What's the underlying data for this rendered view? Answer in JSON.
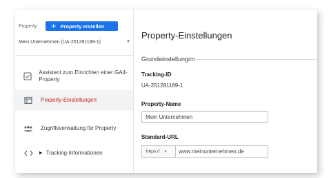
{
  "sidebar": {
    "property_label": "Property",
    "create_button_label": "Property erstellen",
    "account_selector": "Mein Unternehmen (UA-251281189-1)",
    "items": [
      {
        "icon": "checklist-icon",
        "label": "Assistent zum Einrichten einer GA4-Property",
        "active": false
      },
      {
        "icon": "page-layout-icon",
        "label": "Property-Einstellungen",
        "active": true
      },
      {
        "icon": "people-icon",
        "label": "Zugriffsverwaltung für Property",
        "active": false
      },
      {
        "icon": "code-icon",
        "label": "Tracking-Informationen",
        "active": false,
        "expandable": true
      }
    ]
  },
  "main": {
    "page_title": "Property-Einstellungen",
    "section_title": "Grundeinstellungen",
    "tracking_id_label": "Tracking-ID",
    "tracking_id_value": "UA-251281189-1",
    "property_name_label": "Property-Name",
    "property_name_value": "Mein Unternehmen",
    "standard_url_label": "Standard-URL",
    "url_scheme": "https://",
    "url_value": "www.meinunternehmen.de"
  },
  "colors": {
    "accent": "#1a73e8",
    "active_text": "#c5221f",
    "active_bg": "#f1f3f4"
  }
}
